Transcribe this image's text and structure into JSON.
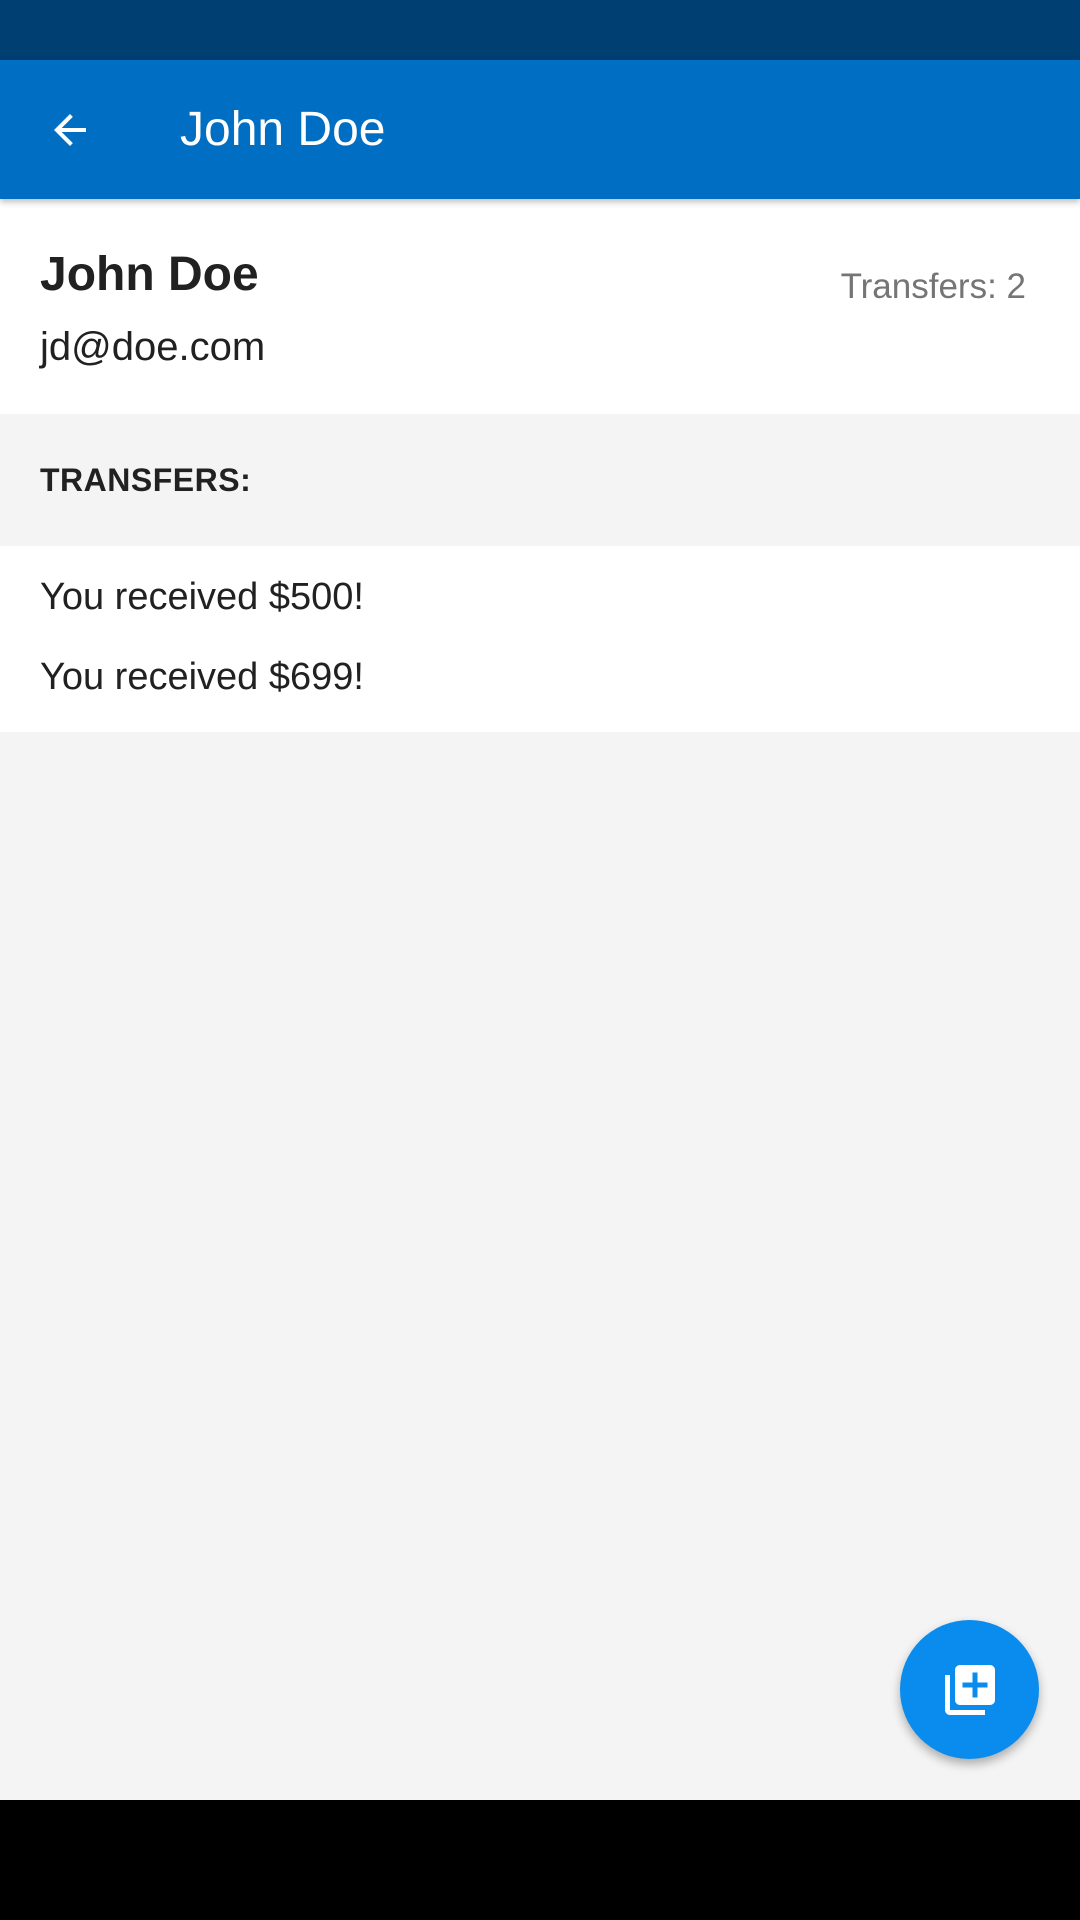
{
  "colors": {
    "status_bar": "#003f72",
    "app_bar": "#006fc3",
    "fab": "#0a8cee",
    "nav_bar": "#000000"
  },
  "app_bar": {
    "back_icon": "arrow-back-icon",
    "title": "John Doe"
  },
  "profile": {
    "name": "John Doe",
    "email": "jd@doe.com",
    "transfer_count": "Transfers: 2"
  },
  "transfers": {
    "header": "TRANSFERS:",
    "items": [
      {
        "text": "You received $500!"
      },
      {
        "text": "You received $699!"
      }
    ]
  },
  "fab": {
    "icon": "add-to-collection-icon"
  }
}
